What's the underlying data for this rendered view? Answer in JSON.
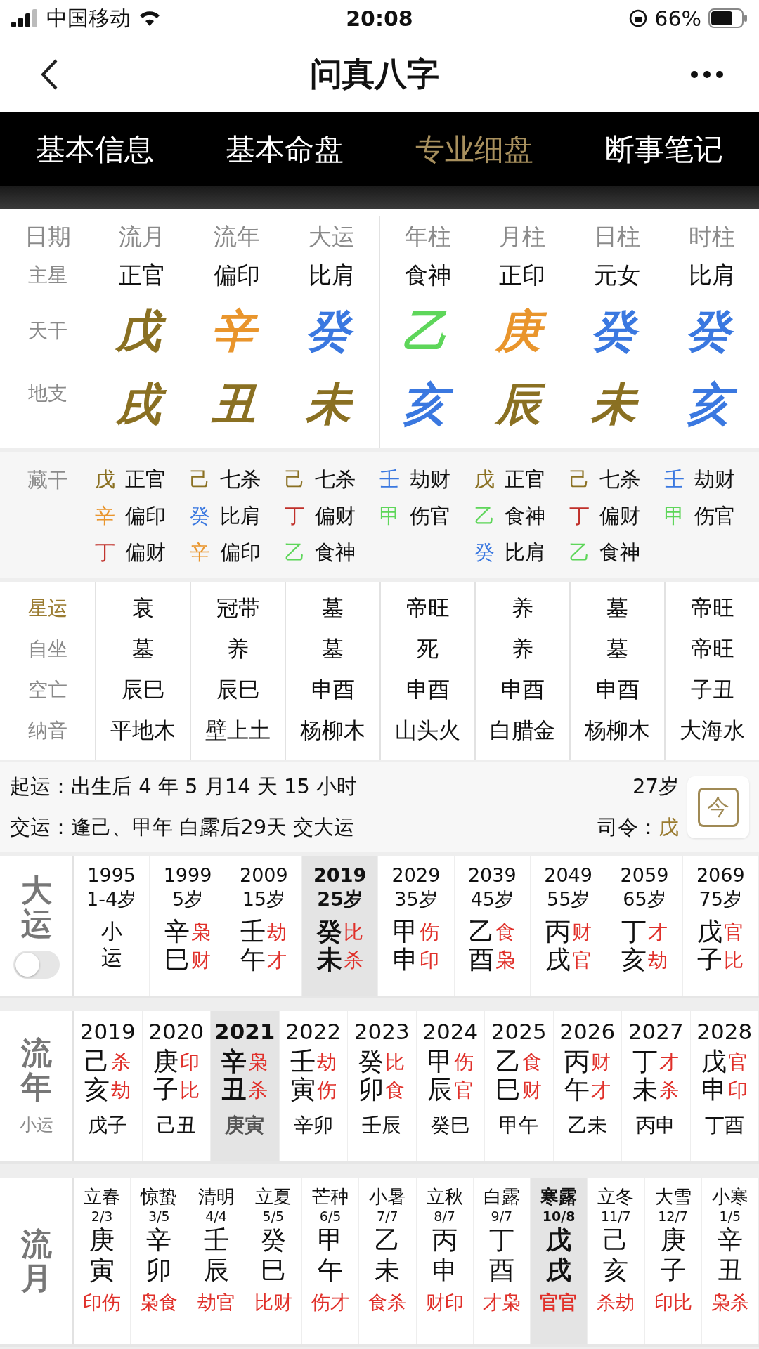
{
  "status_bar": {
    "carrier": "中国移动",
    "time": "20:08",
    "battery": "66%"
  },
  "nav": {
    "title": "问真八字"
  },
  "tabs": [
    {
      "label": "基本信息",
      "selected": false
    },
    {
      "label": "基本命盘",
      "selected": false
    },
    {
      "label": "专业细盘",
      "selected": true
    },
    {
      "label": "断事笔记",
      "selected": false
    }
  ],
  "chart": {
    "row_labels": [
      "日期",
      "主星",
      "天干",
      "地支"
    ],
    "columns": [
      {
        "title": "流月",
        "star": "正官",
        "stem": {
          "text": "戊",
          "color": "#8a7022"
        },
        "branch": {
          "text": "戌",
          "color": "#8a7022"
        }
      },
      {
        "title": "流年",
        "star": "偏印",
        "stem": {
          "text": "辛",
          "color": "#e9952c"
        },
        "branch": {
          "text": "丑",
          "color": "#8a7022"
        }
      },
      {
        "title": "大运",
        "star": "比肩",
        "stem": {
          "text": "癸",
          "color": "#3a78e0"
        },
        "branch": {
          "text": "未",
          "color": "#8a7022"
        }
      },
      {
        "title": "年柱",
        "star": "食神",
        "stem": {
          "text": "乙",
          "color": "#5ed65a"
        },
        "branch": {
          "text": "亥",
          "color": "#3a78e0"
        }
      },
      {
        "title": "月柱",
        "star": "正印",
        "stem": {
          "text": "庚",
          "color": "#e9952c"
        },
        "branch": {
          "text": "辰",
          "color": "#8a7022"
        }
      },
      {
        "title": "日柱",
        "star": "元女",
        "stem": {
          "text": "癸",
          "color": "#3a78e0"
        },
        "branch": {
          "text": "未",
          "color": "#8a7022"
        }
      },
      {
        "title": "时柱",
        "star": "比肩",
        "stem": {
          "text": "癸",
          "color": "#3a78e0"
        },
        "branch": {
          "text": "亥",
          "color": "#3a78e0"
        }
      }
    ]
  },
  "hidden_stems": {
    "label": "藏干",
    "columns": [
      [
        {
          "stem": "戊",
          "color": "#8a7022",
          "god": "正官"
        },
        {
          "stem": "辛",
          "color": "#e9952c",
          "god": "偏印"
        },
        {
          "stem": "丁",
          "color": "#c0302a",
          "god": "偏财"
        }
      ],
      [
        {
          "stem": "己",
          "color": "#8a7022",
          "god": "七杀"
        },
        {
          "stem": "癸",
          "color": "#3a78e0",
          "god": "比肩"
        },
        {
          "stem": "辛",
          "color": "#e9952c",
          "god": "偏印"
        }
      ],
      [
        {
          "stem": "己",
          "color": "#8a7022",
          "god": "七杀"
        },
        {
          "stem": "丁",
          "color": "#c0302a",
          "god": "偏财"
        },
        {
          "stem": "乙",
          "color": "#5ed65a",
          "god": "食神"
        }
      ],
      [
        {
          "stem": "壬",
          "color": "#3a78e0",
          "god": "劫财"
        },
        {
          "stem": "甲",
          "color": "#5ed65a",
          "god": "伤官"
        }
      ],
      [
        {
          "stem": "戊",
          "color": "#8a7022",
          "god": "正官"
        },
        {
          "stem": "乙",
          "color": "#5ed65a",
          "god": "食神"
        },
        {
          "stem": "癸",
          "color": "#3a78e0",
          "god": "比肩"
        }
      ],
      [
        {
          "stem": "己",
          "color": "#8a7022",
          "god": "七杀"
        },
        {
          "stem": "丁",
          "color": "#c0302a",
          "god": "偏财"
        },
        {
          "stem": "乙",
          "color": "#5ed65a",
          "god": "食神"
        }
      ],
      [
        {
          "stem": "壬",
          "color": "#3a78e0",
          "god": "劫财"
        },
        {
          "stem": "甲",
          "color": "#5ed65a",
          "god": "伤官"
        }
      ]
    ]
  },
  "details": [
    {
      "label": "星运",
      "color": "#9a7b30",
      "values": [
        "衰",
        "冠带",
        "墓",
        "帝旺",
        "养",
        "墓",
        "帝旺"
      ]
    },
    {
      "label": "自坐",
      "color": "#8a8a8a",
      "values": [
        "墓",
        "养",
        "墓",
        "死",
        "养",
        "墓",
        "帝旺"
      ]
    },
    {
      "label": "空亡",
      "color": "#8a8a8a",
      "values": [
        "辰巳",
        "辰巳",
        "申酉",
        "申酉",
        "申酉",
        "申酉",
        "子丑"
      ]
    },
    {
      "label": "纳音",
      "color": "#8a8a8a",
      "values": [
        "平地木",
        "壁上土",
        "杨柳木",
        "山头火",
        "白腊金",
        "杨柳木",
        "大海水"
      ]
    }
  ],
  "luck_start": {
    "start_label": "起运：",
    "start_text": "出生后 4 年 5 月14 天 15 小时",
    "age": "27岁",
    "change_label": "交运：",
    "change_text": "逢己、甲年 白露后29天 交大运",
    "commander_label": "司令：",
    "commander": "戊",
    "today_button": "今"
  },
  "dayun": {
    "label": "大运",
    "toggle_on": false,
    "items": [
      {
        "kind": "minor",
        "year": "1995",
        "age": "1-4岁",
        "text": "小运",
        "selected": false
      },
      {
        "kind": "pillar",
        "year": "1999",
        "age": "5岁",
        "stem": "辛",
        "branch": "巳",
        "stem_god": "枭",
        "branch_god": "财",
        "selected": false
      },
      {
        "kind": "pillar",
        "year": "2009",
        "age": "15岁",
        "stem": "壬",
        "branch": "午",
        "stem_god": "劫",
        "branch_god": "才",
        "selected": false
      },
      {
        "kind": "pillar",
        "year": "2019",
        "age": "25岁",
        "stem": "癸",
        "branch": "未",
        "stem_god": "比",
        "branch_god": "杀",
        "selected": true
      },
      {
        "kind": "pillar",
        "year": "2029",
        "age": "35岁",
        "stem": "甲",
        "branch": "申",
        "stem_god": "伤",
        "branch_god": "印",
        "selected": false
      },
      {
        "kind": "pillar",
        "year": "2039",
        "age": "45岁",
        "stem": "乙",
        "branch": "酉",
        "stem_god": "食",
        "branch_god": "枭",
        "selected": false
      },
      {
        "kind": "pillar",
        "year": "2049",
        "age": "55岁",
        "stem": "丙",
        "branch": "戌",
        "stem_god": "财",
        "branch_god": "官",
        "selected": false
      },
      {
        "kind": "pillar",
        "year": "2059",
        "age": "65岁",
        "stem": "丁",
        "branch": "亥",
        "stem_god": "才",
        "branch_god": "劫",
        "selected": false
      },
      {
        "kind": "pillar",
        "year": "2069",
        "age": "75岁",
        "stem": "戊",
        "branch": "子",
        "stem_god": "官",
        "branch_god": "比",
        "selected": false
      }
    ]
  },
  "liunian": {
    "label": "流年",
    "sub_label": "小运",
    "items": [
      {
        "year": "2019",
        "stem": "己",
        "branch": "亥",
        "stem_god": "杀",
        "branch_god": "劫",
        "minor": "戊子",
        "selected": false
      },
      {
        "year": "2020",
        "stem": "庚",
        "branch": "子",
        "stem_god": "印",
        "branch_god": "比",
        "minor": "己丑",
        "selected": false
      },
      {
        "year": "2021",
        "stem": "辛",
        "branch": "丑",
        "stem_god": "枭",
        "branch_god": "杀",
        "minor": "庚寅",
        "selected": true
      },
      {
        "year": "2022",
        "stem": "壬",
        "branch": "寅",
        "stem_god": "劫",
        "branch_god": "伤",
        "minor": "辛卯",
        "selected": false
      },
      {
        "year": "2023",
        "stem": "癸",
        "branch": "卯",
        "stem_god": "比",
        "branch_god": "食",
        "minor": "壬辰",
        "selected": false
      },
      {
        "year": "2024",
        "stem": "甲",
        "branch": "辰",
        "stem_god": "伤",
        "branch_god": "官",
        "minor": "癸巳",
        "selected": false
      },
      {
        "year": "2025",
        "stem": "乙",
        "branch": "巳",
        "stem_god": "食",
        "branch_god": "财",
        "minor": "甲午",
        "selected": false
      },
      {
        "year": "2026",
        "stem": "丙",
        "branch": "午",
        "stem_god": "财",
        "branch_god": "才",
        "minor": "乙未",
        "selected": false
      },
      {
        "year": "2027",
        "stem": "丁",
        "branch": "未",
        "stem_god": "才",
        "branch_god": "杀",
        "minor": "丙申",
        "selected": false
      },
      {
        "year": "2028",
        "stem": "戊",
        "branch": "申",
        "stem_god": "官",
        "branch_god": "印",
        "minor": "丁酉",
        "selected": false
      }
    ]
  },
  "liuyue": {
    "label": "流月",
    "items": [
      {
        "term": "立春",
        "date": "2/3",
        "stem": "庚",
        "branch": "寅",
        "gods": "印伤",
        "selected": false
      },
      {
        "term": "惊蛰",
        "date": "3/5",
        "stem": "辛",
        "branch": "卯",
        "gods": "枭食",
        "selected": false
      },
      {
        "term": "清明",
        "date": "4/4",
        "stem": "壬",
        "branch": "辰",
        "gods": "劫官",
        "selected": false
      },
      {
        "term": "立夏",
        "date": "5/5",
        "stem": "癸",
        "branch": "巳",
        "gods": "比财",
        "selected": false
      },
      {
        "term": "芒种",
        "date": "6/5",
        "stem": "甲",
        "branch": "午",
        "gods": "伤才",
        "selected": false
      },
      {
        "term": "小暑",
        "date": "7/7",
        "stem": "乙",
        "branch": "未",
        "gods": "食杀",
        "selected": false
      },
      {
        "term": "立秋",
        "date": "8/7",
        "stem": "丙",
        "branch": "申",
        "gods": "财印",
        "selected": false
      },
      {
        "term": "白露",
        "date": "9/7",
        "stem": "丁",
        "branch": "酉",
        "gods": "才枭",
        "selected": false
      },
      {
        "term": "寒露",
        "date": "10/8",
        "stem": "戊",
        "branch": "戌",
        "gods": "官官",
        "selected": true
      },
      {
        "term": "立冬",
        "date": "11/7",
        "stem": "己",
        "branch": "亥",
        "gods": "杀劫",
        "selected": false
      },
      {
        "term": "大雪",
        "date": "12/7",
        "stem": "庚",
        "branch": "子",
        "gods": "印比",
        "selected": false
      },
      {
        "term": "小寒",
        "date": "1/5",
        "stem": "辛",
        "branch": "丑",
        "gods": "枭杀",
        "selected": false
      }
    ]
  }
}
